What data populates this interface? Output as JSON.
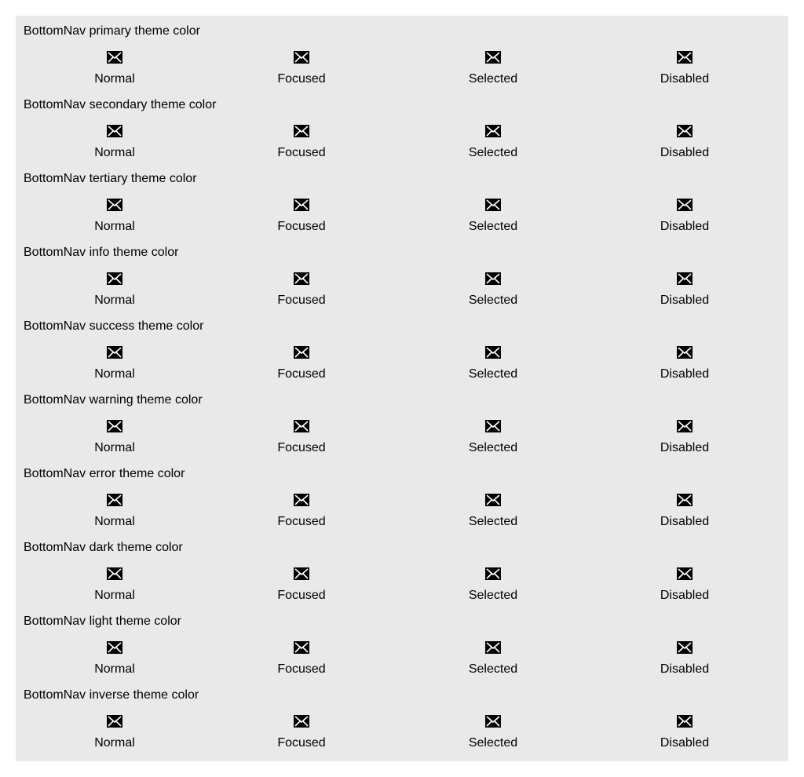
{
  "sections": [
    {
      "title": "BottomNav primary theme color",
      "items": [
        {
          "label": "Normal",
          "icon": "envelope-icon"
        },
        {
          "label": "Focused",
          "icon": "envelope-icon"
        },
        {
          "label": "Selected",
          "icon": "envelope-icon"
        },
        {
          "label": "Disabled",
          "icon": "envelope-icon"
        }
      ]
    },
    {
      "title": "BottomNav secondary theme color",
      "items": [
        {
          "label": "Normal",
          "icon": "envelope-icon"
        },
        {
          "label": "Focused",
          "icon": "envelope-icon"
        },
        {
          "label": "Selected",
          "icon": "envelope-icon"
        },
        {
          "label": "Disabled",
          "icon": "envelope-icon"
        }
      ]
    },
    {
      "title": "BottomNav tertiary theme color",
      "items": [
        {
          "label": "Normal",
          "icon": "envelope-icon"
        },
        {
          "label": "Focused",
          "icon": "envelope-icon"
        },
        {
          "label": "Selected",
          "icon": "envelope-icon"
        },
        {
          "label": "Disabled",
          "icon": "envelope-icon"
        }
      ]
    },
    {
      "title": "BottomNav info theme color",
      "items": [
        {
          "label": "Normal",
          "icon": "envelope-icon"
        },
        {
          "label": "Focused",
          "icon": "envelope-icon"
        },
        {
          "label": "Selected",
          "icon": "envelope-icon"
        },
        {
          "label": "Disabled",
          "icon": "envelope-icon"
        }
      ]
    },
    {
      "title": "BottomNav success theme color",
      "items": [
        {
          "label": "Normal",
          "icon": "envelope-icon"
        },
        {
          "label": "Focused",
          "icon": "envelope-icon"
        },
        {
          "label": "Selected",
          "icon": "envelope-icon"
        },
        {
          "label": "Disabled",
          "icon": "envelope-icon"
        }
      ]
    },
    {
      "title": "BottomNav warning theme color",
      "items": [
        {
          "label": "Normal",
          "icon": "envelope-icon"
        },
        {
          "label": "Focused",
          "icon": "envelope-icon"
        },
        {
          "label": "Selected",
          "icon": "envelope-icon"
        },
        {
          "label": "Disabled",
          "icon": "envelope-icon"
        }
      ]
    },
    {
      "title": "BottomNav error theme color",
      "items": [
        {
          "label": "Normal",
          "icon": "envelope-icon"
        },
        {
          "label": "Focused",
          "icon": "envelope-icon"
        },
        {
          "label": "Selected",
          "icon": "envelope-icon"
        },
        {
          "label": "Disabled",
          "icon": "envelope-icon"
        }
      ]
    },
    {
      "title": "BottomNav dark theme color",
      "items": [
        {
          "label": "Normal",
          "icon": "envelope-icon"
        },
        {
          "label": "Focused",
          "icon": "envelope-icon"
        },
        {
          "label": "Selected",
          "icon": "envelope-icon"
        },
        {
          "label": "Disabled",
          "icon": "envelope-icon"
        }
      ]
    },
    {
      "title": "BottomNav light theme color",
      "items": [
        {
          "label": "Normal",
          "icon": "envelope-icon"
        },
        {
          "label": "Focused",
          "icon": "envelope-icon"
        },
        {
          "label": "Selected",
          "icon": "envelope-icon"
        },
        {
          "label": "Disabled",
          "icon": "envelope-icon"
        }
      ]
    },
    {
      "title": "BottomNav inverse theme color",
      "items": [
        {
          "label": "Normal",
          "icon": "envelope-icon"
        },
        {
          "label": "Focused",
          "icon": "envelope-icon"
        },
        {
          "label": "Selected",
          "icon": "envelope-icon"
        },
        {
          "label": "Disabled",
          "icon": "envelope-icon"
        }
      ]
    }
  ]
}
